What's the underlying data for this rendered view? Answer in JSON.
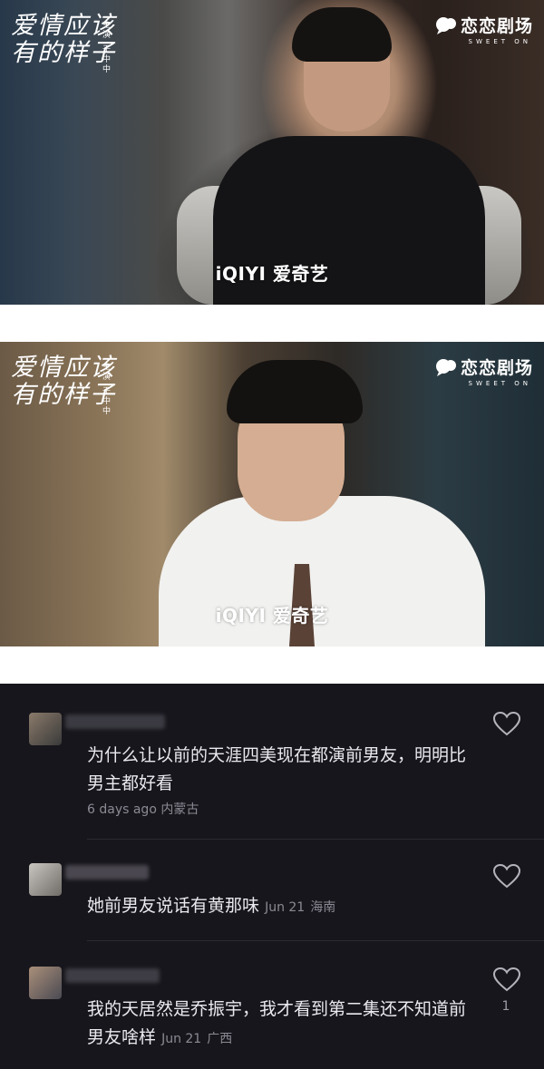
{
  "stills": [
    {
      "show_logo": "爱情应该有的样子",
      "show_logo_small": "主演 于中中",
      "brand": {
        "name": "恋恋剧场",
        "sub": "SWEET ON"
      },
      "watermark": "iQIYI 爱奇艺"
    },
    {
      "show_logo": "爱情应该有的样子",
      "show_logo_small": "主演 于中中",
      "brand": {
        "name": "恋恋剧场",
        "sub": "SWEET ON"
      },
      "watermark": "iQIYI 爱奇艺"
    }
  ],
  "comments": [
    {
      "text": "为什么让以前的天涯四美现在都演前男友，明明比男主都好看",
      "time": "6 days ago",
      "location": "内蒙古",
      "likes": ""
    },
    {
      "text": "她前男友说话有黄那味",
      "time": "Jun 21",
      "location": "海南",
      "likes": ""
    },
    {
      "text": "我的天居然是乔振宇，我才看到第二集还不知道前男友啥样",
      "time": "Jun 21",
      "location": "广西",
      "likes": "1"
    }
  ],
  "icons": {
    "like": "heart-outline-icon",
    "brand": "bubble-logo-icon"
  },
  "colors": {
    "comment_bg": "#17161c",
    "comment_text": "#e9e9ee",
    "meta_text": "#8b8a94"
  }
}
